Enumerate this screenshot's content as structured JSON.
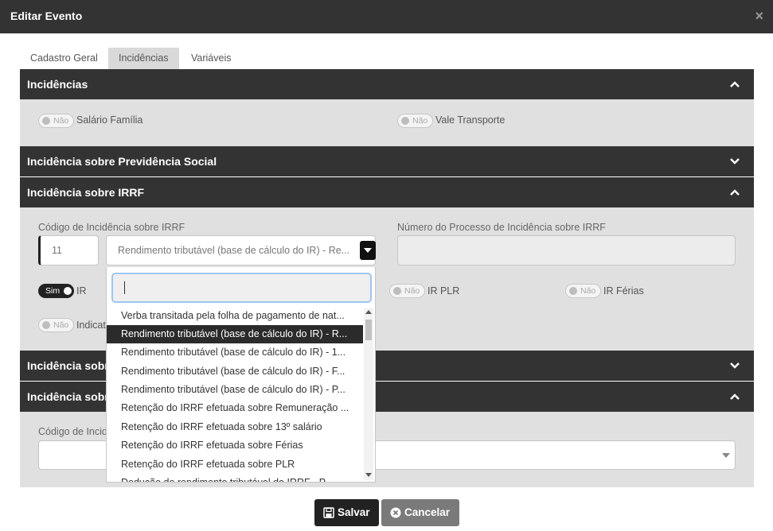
{
  "modal": {
    "title": "Editar Evento",
    "close": "×"
  },
  "tabs": [
    {
      "label": "Cadastro Geral"
    },
    {
      "label": "Incidências"
    },
    {
      "label": "Variáveis"
    }
  ],
  "sections": {
    "incidencias": {
      "title": "Incidências",
      "toggles": [
        {
          "state": "Não",
          "label": "Salário Família"
        },
        {
          "state": "Não",
          "label": "Vale Transporte"
        }
      ]
    },
    "previdencia": {
      "title": "Incidência sobre Previdência Social"
    },
    "irrf": {
      "title": "Incidência sobre IRRF",
      "code_label": "Código de Incidência sobre IRRF",
      "code_value": "11",
      "select_value": "Rendimento tributável (base de cálculo do IR) - Re...",
      "process_label": "Número do Processo de Incidência sobre IRRF",
      "process_value": "",
      "toggles": [
        {
          "state": "Sim",
          "label": "IR"
        },
        {
          "state": "Não",
          "label": "IR PLR"
        },
        {
          "state": "Não",
          "label": "IR Férias"
        },
        {
          "state": "Não",
          "label": "Indicat"
        }
      ]
    },
    "section4": {
      "title": "Incidência sobr"
    },
    "section5": {
      "title": "Incidência sobr",
      "code_label": "Código de Incid"
    }
  },
  "dropdown": {
    "search_value": "",
    "items": [
      "Verba transitada pela folha de pagamento de nat...",
      "Rendimento tributável (base de cálculo do IR) - R...",
      "Rendimento tributável (base de cálculo do IR) - 1...",
      "Rendimento tributável (base de cálculo do IR) - F...",
      "Rendimento tributável (base de cálculo do IR) - P...",
      "Retenção do IRRF efetuada sobre Remuneração ...",
      "Retenção do IRRF efetuada sobre 13º salário",
      "Retenção do IRRF efetuada sobre Férias",
      "Retenção do IRRF efetuada sobre PLR",
      "Dedução do rendimento tributável do IRRF - P..."
    ],
    "selected_index": 1
  },
  "buttons": {
    "save": "Salvar",
    "cancel": "Cancelar"
  },
  "icons": {
    "close": "close-icon",
    "save": "floppy-disk-icon",
    "cancel": "x-circle-icon",
    "chevron_up": "chevron-up-icon",
    "chevron_down": "chevron-down-icon"
  },
  "colors": {
    "header_bg": "#333333",
    "section_body": "#e0e0e0",
    "accent_dark": "#222222",
    "cancel_bg": "#7a7a7a",
    "search_focus": "#9ec5f0"
  }
}
